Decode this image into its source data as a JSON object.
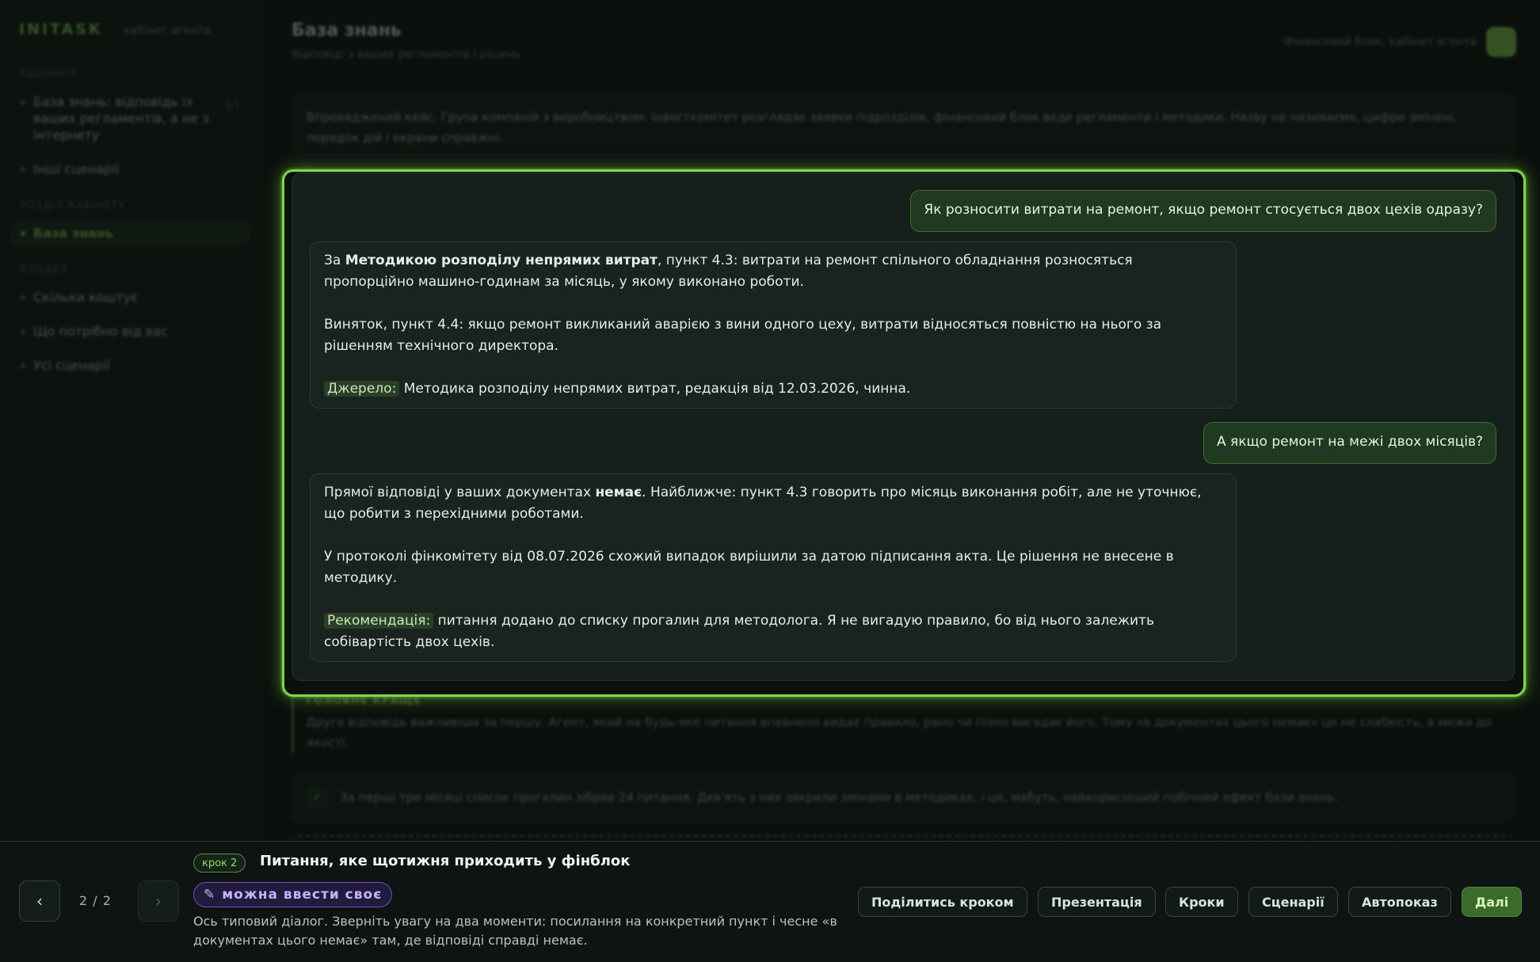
{
  "app": {
    "brand": "INITASK",
    "brand_sub": "кабінет агента"
  },
  "sidebar": {
    "section_scenarios": "СЦЕНАРІЇ",
    "scenarios": [
      {
        "label": "База знань: відповідь із ваших регламентів, а не з інтернету",
        "count": "1/1"
      },
      {
        "label": "Інші сценарії"
      }
    ],
    "section_cabinet": "РОЗДІЛ КАБІНЕТУ",
    "cabinet_items": [
      {
        "label": "База знань"
      }
    ],
    "section_pilot": "ВХОДЕЗ",
    "pilot_items": [
      {
        "label": "Скільки коштує"
      },
      {
        "label": "Що потрібно від вас"
      },
      {
        "label": "Усі сценарії"
      }
    ]
  },
  "header": {
    "title": "База знань",
    "subtitle": "Відповіді з ваших регламентів і рішень",
    "context": "Фінансовий блок, кабінет агента"
  },
  "intro": {
    "text": "Впроваджений кейс. Група компаній з виробництвом: інвесткомітет розглядає заявки підрозділів, фінансовий блок веде регламенти і методики. Назву не називаємо, цифри змінені, порядок дій і екрани справжні."
  },
  "chat": {
    "q1": "Як розносити витрати на ремонт, якщо ремонт стосується двох цехів одразу?",
    "a1": {
      "p1_pre": "За ",
      "p1_bold": "Методикою розподілу непрямих витрат",
      "p1_post": ", пункт 4.3: витрати на ремонт спільного обладнання розносяться пропорційно машино-годинам за місяць, у якому виконано роботи.",
      "p2": "Виняток, пункт 4.4: якщо ремонт викликаний аварією з вини одного цеху, витрати відносяться повністю на нього за рішенням технічного директора.",
      "source_label": "Джерело:",
      "source_text": " Методика розподілу непрямих витрат, редакція від 12.03.2026, чинна."
    },
    "q2": "А якщо ремонт на межі двох місяців?",
    "a2": {
      "p1_pre": "Прямої відповіді у ваших документах ",
      "p1_bold": "немає",
      "p1_post": ". Найближче: пункт 4.3 говорить про місяць виконання робіт, але не уточнює, що робити з перехідними роботами.",
      "p2": "У протоколі фінкомітету від 08.07.2026 схожий випадок вирішили за датою підписання акта. Це рішення не внесене в методику.",
      "rec_label": "Рекомендація:",
      "rec_text": " питання додано до списку прогалин для методолога. Я не вигадую правило, бо від нього залежить собівартість двох цехів."
    }
  },
  "note": {
    "head": "ГОЛОВНЕ КРАЩЕ",
    "text": "Друга відповідь важливіша за першу. Агент, який на будь-яке питання впевнено видає правило, рано чи пізно вигадає його. Тому «в документах цього немає» це не слабкість, а межа до якості."
  },
  "stat": {
    "icon": "check-icon",
    "text": "За перші три місяці список прогалин зібрав 24 питання. Дев'ять з них закрили змінами в методиках, і це, мабуть, найкорисніший побічний ефект бази знань."
  },
  "tour": {
    "counter": "2 / 2",
    "step_badge": "крок 2",
    "step_title": "Питання, яке щотижня приходить у фінблок",
    "edit_pill": "можна ввести своє",
    "description": "Ось типовий діалог. Зверніть увагу на два моменти: посилання на конкретний пункт і чесне «в документах цього немає» там, де відповіді справді немає.",
    "buttons": {
      "share": "Поділитись кроком",
      "present": "Презентація",
      "steps": "Кроки",
      "scenarios": "Сценарії",
      "autoplay": "Автопоказ",
      "next": "Далі"
    }
  },
  "colors": {
    "accent": "#7fd64a",
    "background": "#0b100d",
    "user_bubble": "#1f3a20",
    "pill_purple": "#6b52c0"
  }
}
